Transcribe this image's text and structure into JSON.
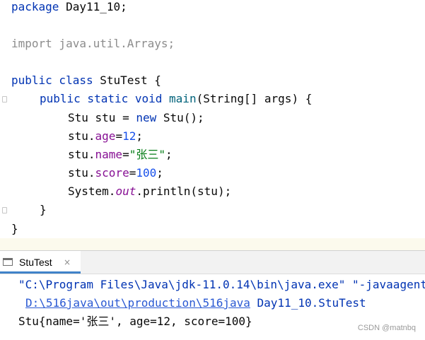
{
  "editor": {
    "lines": {
      "package_kw": "package",
      "package_name": " Day11_10;",
      "import_text": "import java.util.Arrays;",
      "class_public": "public",
      "class_kw": " class",
      "class_name": " StuTest {",
      "main_public": "public",
      "main_static": " static",
      "main_void": " void",
      "main_name": " main",
      "main_params": "(String[] args) {",
      "l1_a": "Stu stu = ",
      "l1_new": "new",
      "l1_b": " Stu();",
      "l2_a": "stu.",
      "l2_field": "age",
      "l2_eq": "=",
      "l2_val": "12",
      "l2_end": ";",
      "l3_a": "stu.",
      "l3_field": "name",
      "l3_eq": "=",
      "l3_val": "\"张三\"",
      "l3_end": ";",
      "l4_a": "stu.",
      "l4_field": "score",
      "l4_eq": "=",
      "l4_val": "100",
      "l4_end": ";",
      "l5_a": "System.",
      "l5_field": "out",
      "l5_b": ".println(stu);",
      "close_method": "}",
      "close_class": "}"
    }
  },
  "run_panel": {
    "tab_label": "StuTest",
    "tab_close": "×",
    "console": {
      "cmd_line": "\"C:\\Program Files\\Java\\jdk-11.0.14\\bin\\java.exe\" \"-javaagent",
      "classpath_link": "D:\\516java\\out\\production\\516java",
      "classpath_rest": " Day11_10.StuTest",
      "output_line": "Stu{name='张三', age=12, score=100}"
    }
  },
  "watermark": "CSDN @matnbq"
}
